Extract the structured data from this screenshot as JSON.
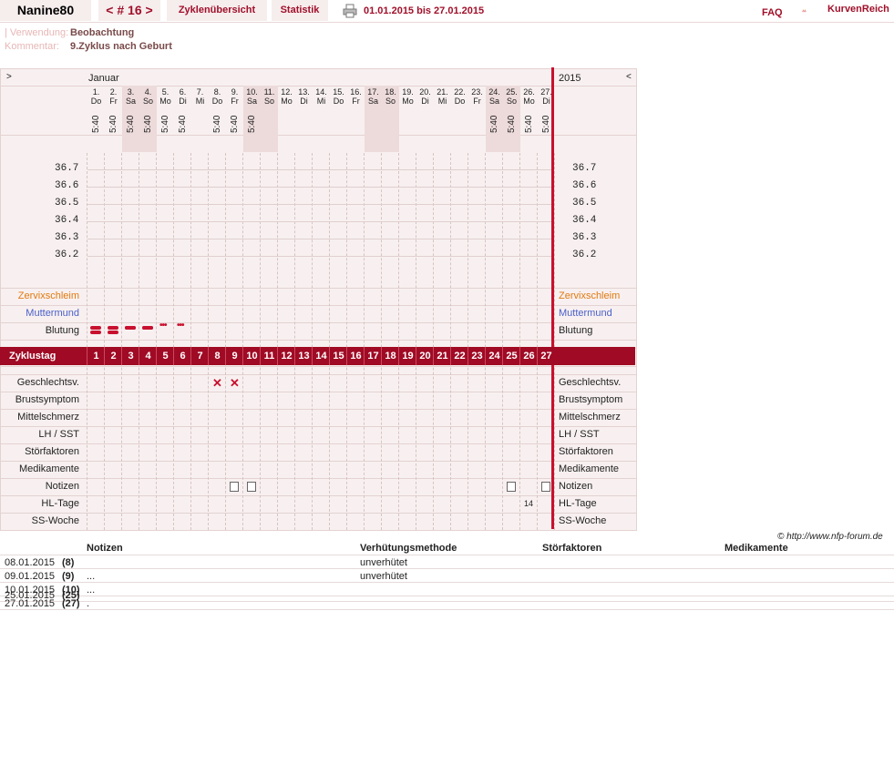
{
  "header": {
    "username": "Nanine80",
    "cycle_nav": "< # 16 >",
    "tab_cycle_overview": "Zyklenübersicht",
    "tab_statistics": "Statistik",
    "date_range": "01.01.2015 bis 27.01.2015",
    "faq": "FAQ",
    "logo": "KurvenReich"
  },
  "meta": {
    "usage_label": "| Verwendung:",
    "usage_value": "Beobachtung",
    "comment_label": "Kommentar:",
    "comment_value": "9.Zyklus nach Geburt"
  },
  "chart": {
    "prev": ">",
    "next": "<",
    "month": "Januar",
    "year": "2015",
    "days": [
      {
        "d": "1.",
        "w": "Do",
        "t": "5:40",
        "we": false
      },
      {
        "d": "2.",
        "w": "Fr",
        "t": "5:40",
        "we": false
      },
      {
        "d": "3.",
        "w": "Sa",
        "t": "5:40",
        "we": true
      },
      {
        "d": "4.",
        "w": "So",
        "t": "5:40",
        "we": true
      },
      {
        "d": "5.",
        "w": "Mo",
        "t": "5:40",
        "we": false
      },
      {
        "d": "6.",
        "w": "Di",
        "t": "5:40",
        "we": false
      },
      {
        "d": "7.",
        "w": "Mi",
        "t": "",
        "we": false
      },
      {
        "d": "8.",
        "w": "Do",
        "t": "5:40",
        "we": false
      },
      {
        "d": "9.",
        "w": "Fr",
        "t": "5:40",
        "we": false
      },
      {
        "d": "10.",
        "w": "Sa",
        "t": "5:40",
        "we": true
      },
      {
        "d": "11.",
        "w": "So",
        "t": "",
        "we": true
      },
      {
        "d": "12.",
        "w": "Mo",
        "t": "",
        "we": false
      },
      {
        "d": "13.",
        "w": "Di",
        "t": "",
        "we": false
      },
      {
        "d": "14.",
        "w": "Mi",
        "t": "",
        "we": false
      },
      {
        "d": "15.",
        "w": "Do",
        "t": "",
        "we": false
      },
      {
        "d": "16.",
        "w": "Fr",
        "t": "",
        "we": false
      },
      {
        "d": "17.",
        "w": "Sa",
        "t": "",
        "we": true
      },
      {
        "d": "18.",
        "w": "So",
        "t": "",
        "we": true
      },
      {
        "d": "19.",
        "w": "Mo",
        "t": "",
        "we": false
      },
      {
        "d": "20.",
        "w": "Di",
        "t": "",
        "we": false
      },
      {
        "d": "21.",
        "w": "Mi",
        "t": "",
        "we": false
      },
      {
        "d": "22.",
        "w": "Do",
        "t": "",
        "we": false
      },
      {
        "d": "23.",
        "w": "Fr",
        "t": "",
        "we": false
      },
      {
        "d": "24.",
        "w": "Sa",
        "t": "5:40",
        "we": true
      },
      {
        "d": "25.",
        "w": "So",
        "t": "5:40",
        "we": true
      },
      {
        "d": "26.",
        "w": "Mo",
        "t": "5:40",
        "we": false
      },
      {
        "d": "27.",
        "w": "Di",
        "t": "5:40",
        "we": false
      }
    ],
    "temps": [
      "36.7",
      "36.6",
      "36.5",
      "36.4",
      "36.3",
      "36.2"
    ],
    "rows": {
      "zervix": "Zervixschleim",
      "muttermund": "Muttermund",
      "blutung": "Blutung",
      "zyklustag": "Zyklustag",
      "gv": "Geschlechtsv.",
      "brust": "Brustsymptom",
      "mittel": "Mittelschmerz",
      "lh": "LH / SST",
      "stoer": "Störfaktoren",
      "medi": "Medikamente",
      "notizen": "Notizen",
      "hl": "HL-Tage",
      "ss": "SS-Woche"
    },
    "bleeding_heavy_days": [
      1,
      2,
      3,
      4
    ],
    "bleeding_light_days": [
      5,
      6
    ],
    "intercourse_days": [
      8,
      9
    ],
    "note_days": [
      9,
      10,
      25,
      27
    ],
    "hl_day": 26,
    "hl_value": "14",
    "colors": {
      "accent": "#a00a24",
      "zervix": "#e07a10",
      "muttermund": "#4a5fc8",
      "bleeding": "#c8102e"
    }
  },
  "copyright": "© http://www.nfp-forum.de",
  "table": {
    "headers": [
      "Notizen",
      "Verhütungsmethode",
      "Störfaktoren",
      "Medikamente"
    ],
    "rows": [
      {
        "date": "08.01.2015",
        "day": "(8)",
        "note": "",
        "method": "unverhütet"
      },
      {
        "date": "09.01.2015",
        "day": "(9)",
        "note": "...",
        "method": "unverhütet"
      },
      {
        "date": "10.01.2015",
        "day": "(10)",
        "note": "...",
        "method": ""
      },
      {
        "date": "25.01.2015",
        "day": "(25)",
        "note": "",
        "method": ""
      },
      {
        "date": "27.01.2015",
        "day": "(27)",
        "note": ".",
        "method": ""
      }
    ]
  }
}
